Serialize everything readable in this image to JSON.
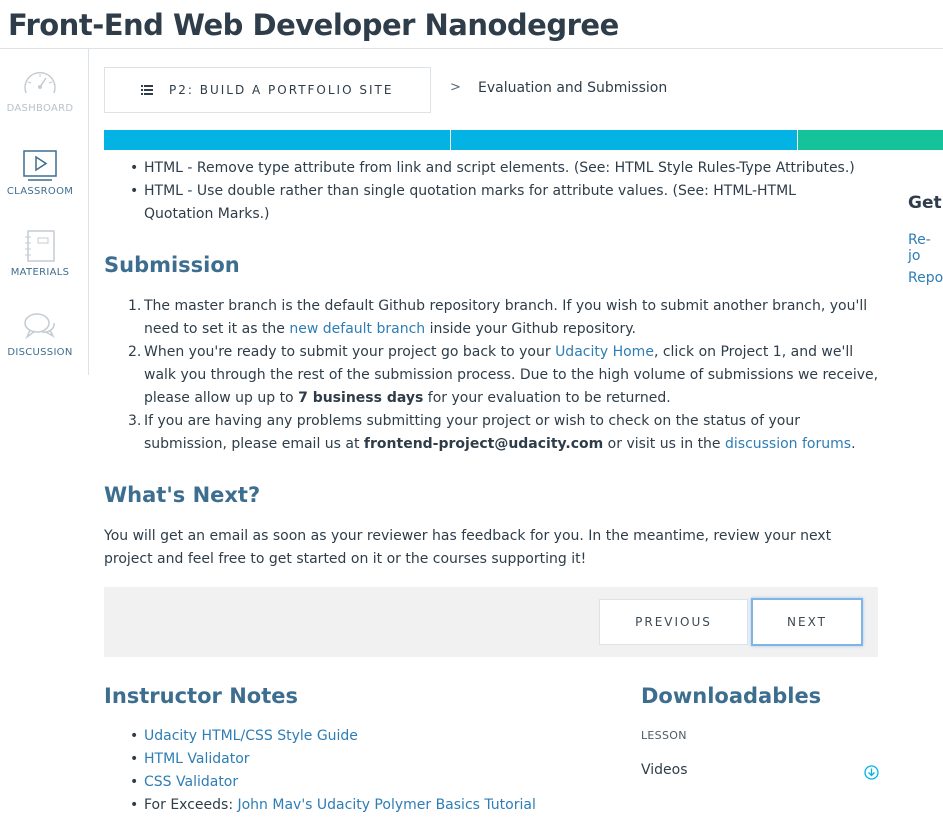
{
  "header": {
    "title": "Front-End Web Developer Nanodegree"
  },
  "sidebar": {
    "items": [
      {
        "label": "DASHBOARD",
        "icon": "gauge-icon"
      },
      {
        "label": "CLASSROOM",
        "icon": "play-icon"
      },
      {
        "label": "MATERIALS",
        "icon": "notebook-icon"
      },
      {
        "label": "DISCUSSION",
        "icon": "chat-bubbles-icon"
      }
    ]
  },
  "breadcrumb": {
    "lesson": "P2: BUILD A PORTFOLIO SITE",
    "separator": ">",
    "current": "Evaluation and Submission"
  },
  "progress": {
    "colors": [
      "#02b3e4",
      "#02b3e4",
      "#15c39a"
    ]
  },
  "style_rules": [
    "HTML - Remove type attribute from link and script elements. (See: HTML Style Rules-Type Attributes.)",
    "HTML - Use double rather than single quotation marks for attribute values. (See: HTML-HTML Quotation Marks.)"
  ],
  "submission": {
    "heading": "Submission",
    "steps": [
      {
        "num": "1.",
        "t1": "The master branch is the default Github repository branch. If you wish to submit another branch, you'll need to set it as the ",
        "link": "new default branch",
        "t2": " inside your Github repository."
      },
      {
        "num": "2.",
        "t1": "When you're ready to submit your project go back to your ",
        "link": "Udacity Home",
        "t2": ", click on Project 1, and we'll walk you through the rest of the submission process. Due to the high volume of submissions we receive, please allow up up to ",
        "bold": "7 business days",
        "t3": " for your evaluation to be returned."
      },
      {
        "num": "3.",
        "t1": "If you are having any problems submitting your project or wish to check on the status of your submission, please email us at ",
        "bold": "frontend-project@udacity.com",
        "t2": " or visit us in the ",
        "link": "discussion forums",
        "t3": "."
      }
    ]
  },
  "whats_next": {
    "heading": "What's Next?",
    "text": "You will get an email as soon as your reviewer has feedback for you. In the meantime, review your next project and feel free to get started on it or the courses supporting it!"
  },
  "nav": {
    "previous": "PREVIOUS",
    "next": "NEXT"
  },
  "instructor_notes": {
    "heading": "Instructor Notes",
    "links": [
      "Udacity HTML/CSS Style Guide",
      "HTML Validator",
      "CSS Validator"
    ],
    "exceeds_prefix": "For Exceeds: ",
    "exceeds_link": "John Mav's Udacity Polymer Basics Tutorial"
  },
  "downloadables": {
    "heading": "Downloadables",
    "section": "LESSON",
    "item": "Videos",
    "icon": "download-icon"
  },
  "right_panel": {
    "heading": "Get",
    "link1": "Re-jo",
    "link2": "Repo"
  }
}
